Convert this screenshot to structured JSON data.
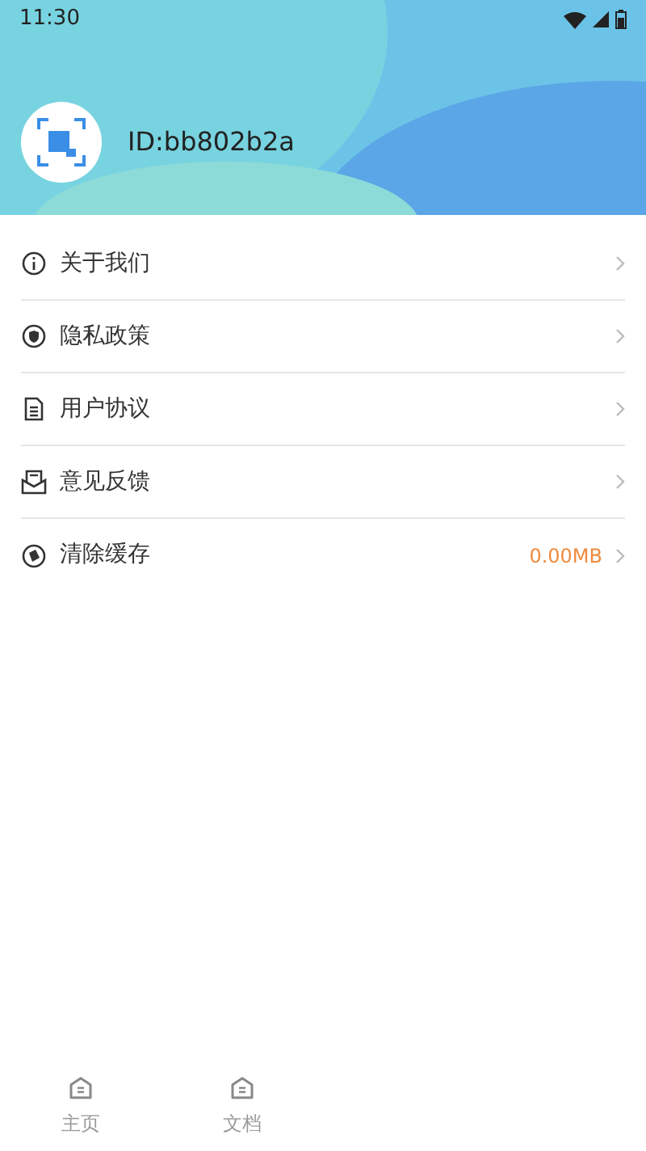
{
  "status_bar": {
    "time": "11:30"
  },
  "profile": {
    "id_text": "ID:bb802b2a"
  },
  "menu": [
    {
      "kind": "info",
      "label": "关于我们"
    },
    {
      "kind": "shield",
      "label": "隐私政策"
    },
    {
      "kind": "document",
      "label": "用户协议"
    },
    {
      "kind": "mail",
      "label": "意见反馈"
    },
    {
      "kind": "clean",
      "label": "清除缓存",
      "value": "0.00MB"
    }
  ],
  "bottom_nav": [
    {
      "label": "主页",
      "selected": false
    },
    {
      "label": "文档",
      "selected": false
    }
  ]
}
